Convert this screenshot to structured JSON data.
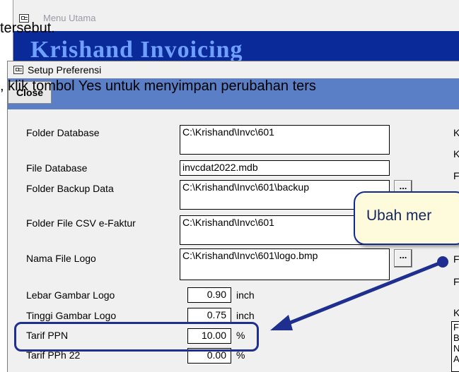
{
  "background_doc": {
    "line1": "tersebut.",
    "line2": ", klik tombol Yes untuk menyimpan perubahan ters"
  },
  "main_window": {
    "title": "Menu Utama",
    "banner": "Krishand Invoicing"
  },
  "setup_window": {
    "title": "Setup Preferensi",
    "close_label": "Close",
    "fields": {
      "folder_database": {
        "label": "Folder Database",
        "value": "C:\\Krishand\\Invc\\601"
      },
      "file_database": {
        "label": "File Database",
        "value": "invcdat2022.mdb"
      },
      "folder_backup": {
        "label": "Folder Backup Data",
        "value": "C:\\Krishand\\Invc\\601\\backup"
      },
      "folder_csv": {
        "label": "Folder File CSV e-Faktur",
        "value": "C:\\Krishand\\Invc\\601"
      },
      "nama_file_logo": {
        "label": "Nama File Logo",
        "value": "C:\\Krishand\\Invc\\601\\logo.bmp"
      },
      "lebar_logo": {
        "label": "Lebar Gambar Logo",
        "value": "0.90",
        "unit": "inch"
      },
      "tinggi_logo": {
        "label": "Tinggi Gambar Logo",
        "value": "0.75",
        "unit": "inch"
      },
      "tarif_ppn": {
        "label": "Tarif PPN",
        "value": "10.00",
        "unit": "%"
      },
      "tarif_pph22": {
        "label": "Tarif PPh 22",
        "value": "0.00",
        "unit": "%"
      }
    },
    "browse_label": "...",
    "right_edge_labels": [
      "K",
      "K",
      "F",
      "F",
      "F",
      "K"
    ],
    "right_edge_box_lines": [
      "F",
      "B",
      "N",
      "A"
    ]
  },
  "callout": {
    "text": "Ubah mer"
  },
  "colors": {
    "banner_bg": "#0b2a99",
    "toolbar_bg": "#5b7fc6",
    "annotation": "#1e2f8f",
    "callout_bg": "#fdfbdc"
  }
}
